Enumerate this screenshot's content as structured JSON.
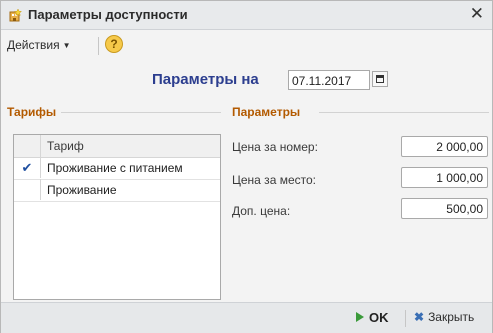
{
  "window": {
    "title": "Параметры доступности",
    "close_glyph": "✕"
  },
  "toolbar": {
    "actions_label": "Действия",
    "actions_caret": "▼",
    "help_glyph": "?"
  },
  "header": {
    "label": "Параметры на",
    "date_value": "07.11.2017"
  },
  "tariffs": {
    "group_title": "Тарифы",
    "column_header": "Тариф",
    "rows": [
      {
        "name": "Проживание с питанием",
        "mark": "✔"
      },
      {
        "name": "Проживание",
        "mark": ""
      }
    ]
  },
  "params": {
    "group_title": "Параметры",
    "room_price_label": "Цена за номер:",
    "room_price_value": "2 000,00",
    "bed_price_label": "Цена за место:",
    "bed_price_value": "1 000,00",
    "extra_price_label": "Доп. цена:",
    "extra_price_value": "500,00"
  },
  "footer": {
    "ok_label": "OK",
    "close_label": "Закрыть",
    "close_glyph": "✖"
  },
  "colors": {
    "heading": "#2c3e8f",
    "group_title": "#b35a00",
    "ok_arrow": "#3a9a3a"
  }
}
